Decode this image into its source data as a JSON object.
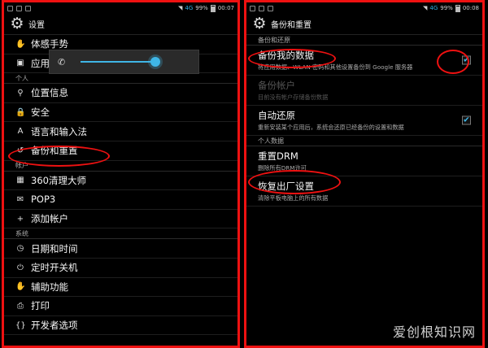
{
  "left": {
    "status": {
      "net": "4G",
      "battery": "99%",
      "time": "00:07"
    },
    "title": "设置",
    "volume_popup": {
      "icon": "phone-icon",
      "level": 1.0
    },
    "items": [
      {
        "type": "item",
        "icon": "✋",
        "icon_name": "motion-icon",
        "label": "体感手势"
      },
      {
        "type": "item",
        "icon": "▣",
        "icon_name": "apps-icon",
        "label": "应用"
      },
      {
        "type": "section",
        "label": "个人"
      },
      {
        "type": "item",
        "icon": "⚲",
        "icon_name": "location-icon",
        "label": "位置信息"
      },
      {
        "type": "item",
        "icon": "🔒",
        "icon_name": "lock-icon",
        "label": "安全"
      },
      {
        "type": "item",
        "icon": "A",
        "icon_name": "language-icon",
        "label": "语言和输入法"
      },
      {
        "type": "item",
        "icon": "↺",
        "icon_name": "backup-icon",
        "label": "备份和重置"
      },
      {
        "type": "section",
        "label": "帐户"
      },
      {
        "type": "item",
        "icon": "▦",
        "icon_name": "360-icon",
        "label": "360清理大师"
      },
      {
        "type": "item",
        "icon": "✉",
        "icon_name": "email-icon",
        "label": "POP3"
      },
      {
        "type": "item",
        "icon": "+",
        "icon_name": "add-icon",
        "label": "添加帐户"
      },
      {
        "type": "section",
        "label": "系统"
      },
      {
        "type": "item",
        "icon": "◷",
        "icon_name": "clock-icon",
        "label": "日期和时间"
      },
      {
        "type": "item",
        "icon": "⏻",
        "icon_name": "power-icon",
        "label": "定时开关机"
      },
      {
        "type": "item",
        "icon": "✋",
        "icon_name": "accessibility-icon",
        "label": "辅助功能"
      },
      {
        "type": "item",
        "icon": "⎙",
        "icon_name": "print-icon",
        "label": "打印"
      },
      {
        "type": "item",
        "icon": "{}",
        "icon_name": "developer-icon",
        "label": "开发者选项"
      }
    ]
  },
  "right": {
    "status": {
      "net": "4G",
      "battery": "99%",
      "time": "00:08"
    },
    "title": "备份和重置",
    "section1": "备份和还原",
    "rows1": [
      {
        "title": "备份我的数据",
        "subtitle": "将应用数据、WLAN 密码和其他设置备份到 Google 服务器",
        "checked": true,
        "disabled": false
      },
      {
        "title": "备份帐户",
        "subtitle": "目前没有帐户存储备份数据",
        "checked": false,
        "disabled": true
      },
      {
        "title": "自动还原",
        "subtitle": "重新安装某个应用后，系统会还原已经备份的设置和数据",
        "checked": true,
        "disabled": false
      }
    ],
    "section2": "个人数据",
    "rows2": [
      {
        "title": "重置DRM",
        "subtitle": "删除所有DRM许可"
      },
      {
        "title": "恢复出厂设置",
        "subtitle": "清除平板电脑上的所有数据"
      }
    ]
  },
  "watermark": "爱创根知识网",
  "colors": {
    "accent": "#3fb6e6",
    "annotation": "#e11111",
    "background": "#000000"
  }
}
